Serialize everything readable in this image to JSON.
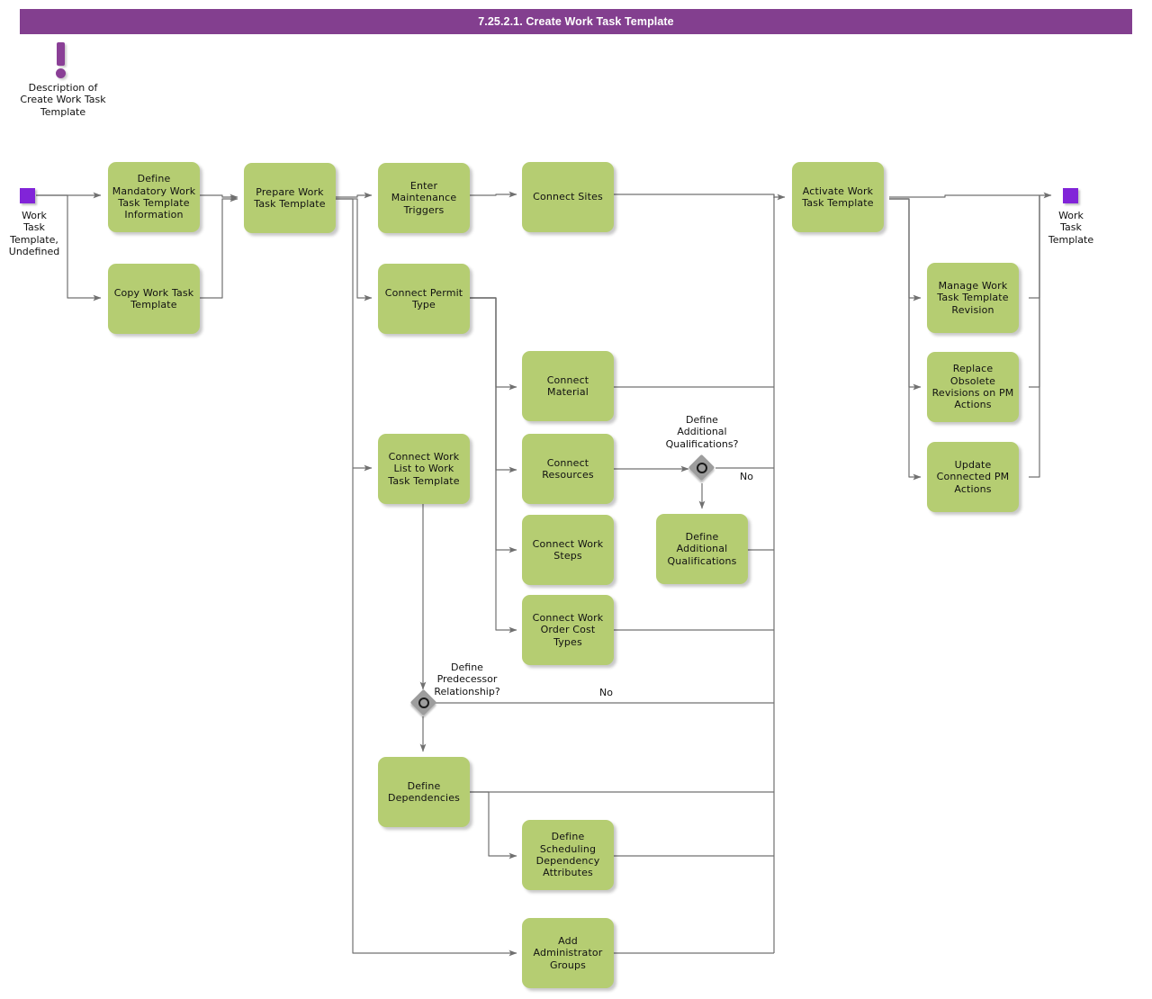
{
  "header": {
    "title": "7.25.2.1. Create Work Task Template",
    "bar_color": "#833f8f"
  },
  "theme": {
    "task_fill": "#b5cd72",
    "event_fill": "#8124d8",
    "gateway_fill": "#9d9d9d",
    "connector_color": "#707070",
    "text_color": "#111111"
  },
  "annotation": {
    "icon": "exclamation-icon",
    "text": "Description of\nCreate Work Task\nTemplate"
  },
  "events": {
    "start": {
      "name": "start-event",
      "label": "Work\nTask\nTemplate,\nUndefined"
    },
    "end": {
      "name": "end-event",
      "label": "Work\nTask\nTemplate"
    }
  },
  "tasks": [
    {
      "id": "define-mandatory-work-task-template-information",
      "label": "Define\nMandatory Work\nTask Template\nInformation"
    },
    {
      "id": "copy-work-task-template",
      "label": "Copy Work Task\nTemplate"
    },
    {
      "id": "prepare-work-task-template",
      "label": "Prepare Work\nTask Template"
    },
    {
      "id": "enter-maintenance-triggers",
      "label": "Enter\nMaintenance\nTriggers"
    },
    {
      "id": "connect-permit-type",
      "label": "Connect Permit\nType"
    },
    {
      "id": "connect-sites",
      "label": "Connect Sites"
    },
    {
      "id": "connect-material",
      "label": "Connect Material"
    },
    {
      "id": "connect-work-list-to-work-task-template",
      "label": "Connect Work\nList to Work\nTask Template"
    },
    {
      "id": "connect-resources",
      "label": "Connect\nResources"
    },
    {
      "id": "connect-work-steps",
      "label": "Connect Work\nSteps"
    },
    {
      "id": "connect-work-order-cost-types",
      "label": "Connect Work\nOrder Cost\nTypes"
    },
    {
      "id": "define-additional-qualifications",
      "label": "Define\nAdditional\nQualifications"
    },
    {
      "id": "define-dependencies",
      "label": "Define\nDependencies"
    },
    {
      "id": "define-scheduling-dependency-attributes",
      "label": "Define\nScheduling\nDependency\nAttributes"
    },
    {
      "id": "add-administrator-groups",
      "label": "Add\nAdministrator\nGroups"
    },
    {
      "id": "activate-work-task-template",
      "label": "Activate Work\nTask Template"
    },
    {
      "id": "manage-work-task-template-revision",
      "label": "Manage Work\nTask Template\nRevision"
    },
    {
      "id": "replace-obsolete-revisions-on-pm-actions",
      "label": "Replace\nObsolete\nRevisions on PM\nActions"
    },
    {
      "id": "update-connected-pm-actions",
      "label": "Update\nConnected PM\nActions"
    }
  ],
  "gateways": [
    {
      "id": "define-additional-qualifications-gateway",
      "label": "Define\nAdditional\nQualifications?",
      "no_label": "No"
    },
    {
      "id": "define-predecessor-relationship-gateway",
      "label": "Define\nPredecessor\nRelationship?",
      "no_label": "No"
    }
  ]
}
